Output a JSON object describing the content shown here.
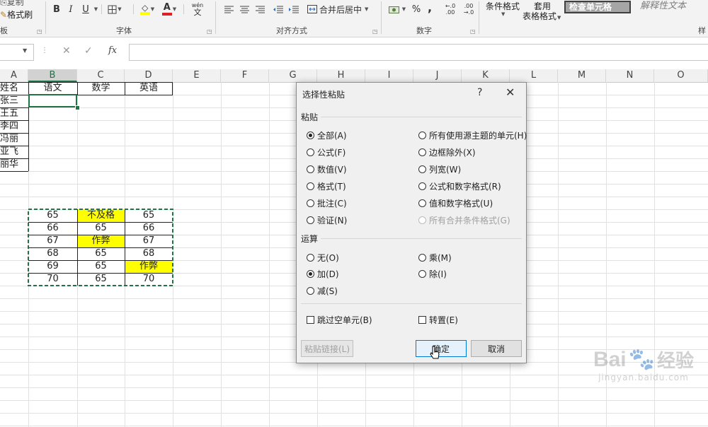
{
  "ribbon": {
    "clipboard": {
      "copy_label": "复制",
      "format_painter_label": "格式刷",
      "group_label": "板"
    },
    "font": {
      "bold": "B",
      "italic": "I",
      "underline": "U",
      "border_icon": "border-icon",
      "fill_icon": "fill-color-icon",
      "fill_color": "#ffff00",
      "font_color_letter": "A",
      "font_color": "#e02020",
      "phonetic_label": "wén",
      "group_label": "字体"
    },
    "alignment": {
      "merge_label": "合并后居中",
      "group_label": "对齐方式"
    },
    "number": {
      "percent": "%",
      "comma": ",",
      "inc_decimal": "←.0 .00",
      "dec_decimal": ".00 →.0",
      "group_label": "数字"
    },
    "styles": {
      "conditional_label": "条件格式",
      "table_label_1": "套用",
      "table_label_2": "表格格式",
      "check_cell_label": "检查单元格",
      "explanatory_label": "解释性文本",
      "group_label": "样"
    }
  },
  "formula_bar": {
    "cancel_icon": "✕",
    "enter_icon": "✓",
    "fx_label": "fx",
    "name_box_value": "",
    "formula_value": ""
  },
  "grid": {
    "columns": [
      "A",
      "B",
      "C",
      "D",
      "E",
      "F",
      "G",
      "H",
      "I",
      "J",
      "K",
      "L",
      "M",
      "N",
      "O"
    ],
    "selected_column": "B",
    "header_row": [
      "姓名",
      "语文",
      "数学",
      "英语"
    ],
    "names": [
      "张三",
      "王五",
      "李四",
      "冯丽",
      "亚飞",
      "丽华"
    ],
    "table_rows": [
      [
        "65",
        "不及格",
        "65"
      ],
      [
        "66",
        "65",
        "66"
      ],
      [
        "67",
        "作弊",
        "67"
      ],
      [
        "68",
        "65",
        "68"
      ],
      [
        "69",
        "65",
        "作弊"
      ],
      [
        "70",
        "65",
        "70"
      ]
    ],
    "highlight_color": "#ffff00"
  },
  "dialog": {
    "title": "选择性粘贴",
    "help": "?",
    "close": "✕",
    "paste_section": "粘贴",
    "paste_left": [
      "全部(A)",
      "公式(F)",
      "数值(V)",
      "格式(T)",
      "批注(C)",
      "验证(N)"
    ],
    "paste_right": [
      "所有使用源主题的单元(H)",
      "边框除外(X)",
      "列宽(W)",
      "公式和数字格式(R)",
      "值和数字格式(U)",
      "所有合并条件格式(G)"
    ],
    "paste_selected": "全部(A)",
    "operation_section": "运算",
    "op_left": [
      "无(O)",
      "加(D)",
      "减(S)"
    ],
    "op_right": [
      "乘(M)",
      "除(I)"
    ],
    "op_selected": "加(D)",
    "skip_blanks": "跳过空单元(B)",
    "transpose": "转置(E)",
    "paste_link": "粘贴链接(L)",
    "ok": "确定",
    "cancel": "取消"
  },
  "watermark": {
    "brand": "Bai",
    "brand_cn": "经验",
    "url": "jingyan.baidu.com"
  }
}
